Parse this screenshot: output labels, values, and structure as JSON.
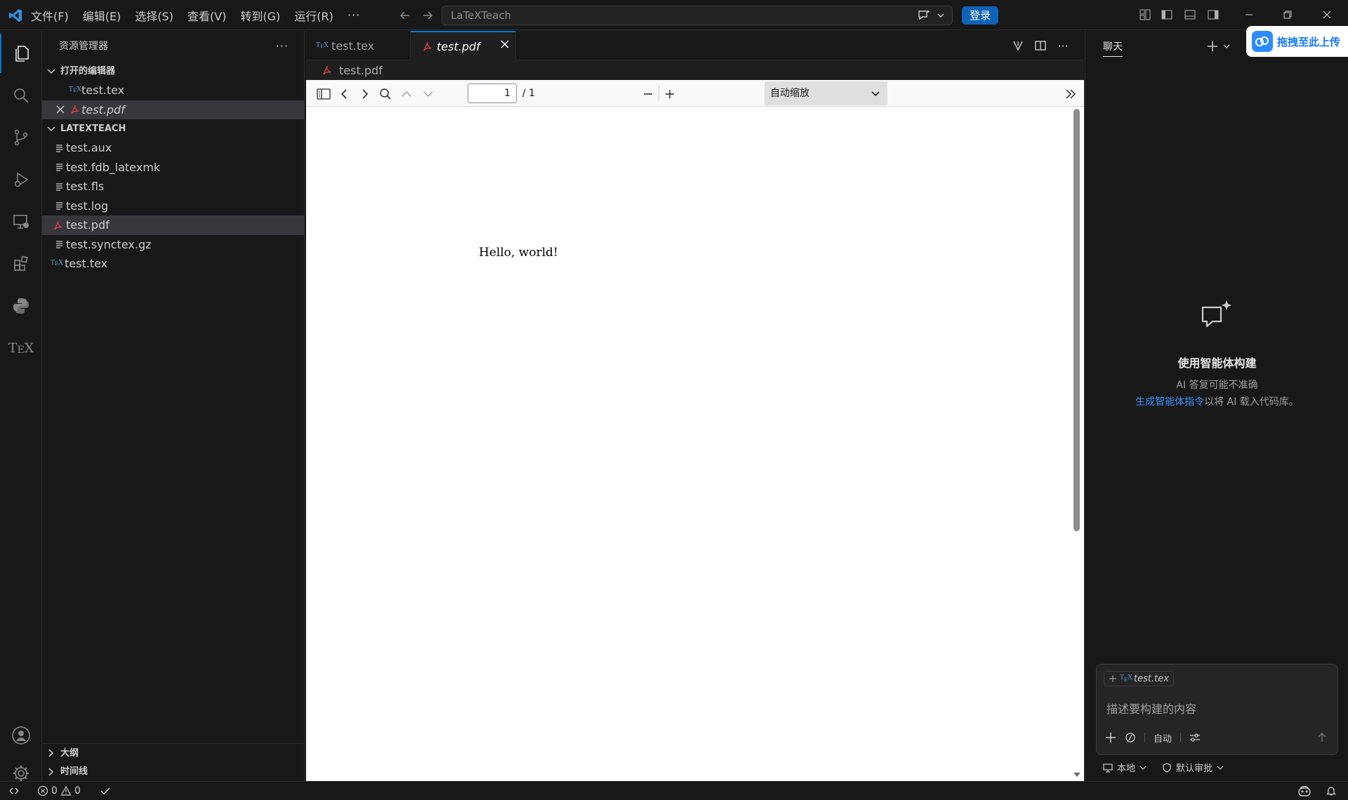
{
  "menu": [
    "文件(F)",
    "编辑(E)",
    "选择(S)",
    "查看(V)",
    "转到(G)",
    "运行(R)"
  ],
  "menu_more": "···",
  "command_center": {
    "placeholder": "LaTeXTeach"
  },
  "login_label": "登录",
  "sidebar": {
    "title": "资源管理器",
    "more": "···",
    "open_editors": {
      "label": "打开的编辑器",
      "items": [
        {
          "name": "test.tex",
          "icon": "tex-icon"
        },
        {
          "name": "test.pdf",
          "icon": "pdf-icon"
        }
      ]
    },
    "workspace": {
      "label": "LATEXTEACH",
      "files": [
        {
          "name": "test.aux",
          "icon": "file-lines-icon"
        },
        {
          "name": "test.fdb_latexmk",
          "icon": "file-lines-icon"
        },
        {
          "name": "test.fls",
          "icon": "file-lines-icon"
        },
        {
          "name": "test.log",
          "icon": "file-lines-icon"
        },
        {
          "name": "test.pdf",
          "icon": "pdf-icon"
        },
        {
          "name": "test.synctex.gz",
          "icon": "file-lines-icon"
        },
        {
          "name": "test.tex",
          "icon": "tex-icon"
        }
      ]
    },
    "outline_label": "大纲",
    "timeline_label": "时间线"
  },
  "tabs": [
    {
      "label": "test.tex",
      "icon": "tex-icon"
    },
    {
      "label": "test.pdf",
      "icon": "pdf-icon"
    }
  ],
  "breadcrumb": "test.pdf",
  "pdf": {
    "page": "1",
    "total": "/ 1",
    "zoom": "自动缩放",
    "content": "Hello, world!"
  },
  "chat": {
    "title": "聊天",
    "upload_label": "拖拽至此上传",
    "empty_heading": "使用智能体构建",
    "empty_sub": "AI 答复可能不准确",
    "link_text": "生成智能体指令",
    "link_suffix": "以将 AI 载入代码库。",
    "context_file": "test.tex",
    "input_placeholder": "描述要构建的内容",
    "mode_label": "自动",
    "footer_local": "本地",
    "footer_approval": "默认审批"
  },
  "status": {
    "errors": "0",
    "warnings": "0"
  },
  "colors": {
    "accent": "#0078d4",
    "login_bg": "#0e63b8",
    "pdf_icon": "#e04040",
    "tex_icon": "#5b9bd5",
    "link": "#3794ff"
  }
}
